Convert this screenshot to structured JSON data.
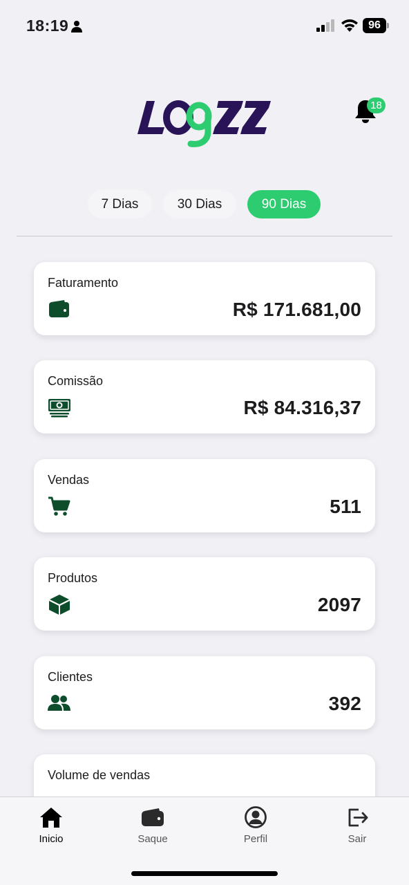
{
  "status_bar": {
    "time": "18:19",
    "battery": "96"
  },
  "header": {
    "logo_text": "LOGZZ",
    "notification_count": "18"
  },
  "tabs": [
    {
      "label": "7 Dias",
      "active": false
    },
    {
      "label": "30 Dias",
      "active": false
    },
    {
      "label": "90 Dias",
      "active": true
    }
  ],
  "cards": [
    {
      "label": "Faturamento",
      "value": "R$ 171.681,00",
      "icon": "wallet-icon"
    },
    {
      "label": "Comissão",
      "value": "R$ 84.316,37",
      "icon": "money-icon"
    },
    {
      "label": "Vendas",
      "value": "511",
      "icon": "cart-icon"
    },
    {
      "label": "Produtos",
      "value": "2097",
      "icon": "box-icon"
    },
    {
      "label": "Clientes",
      "value": "392",
      "icon": "users-icon"
    },
    {
      "label": "Volume de vendas",
      "value": "",
      "icon": ""
    }
  ],
  "bottom_nav": [
    {
      "label": "Inicio",
      "icon": "home-icon",
      "active": true
    },
    {
      "label": "Saque",
      "icon": "wallet-icon",
      "active": false
    },
    {
      "label": "Perfil",
      "icon": "profile-icon",
      "active": false
    },
    {
      "label": "Sair",
      "icon": "logout-icon",
      "active": false
    }
  ],
  "colors": {
    "accent": "#2ecc71",
    "icon_green": "#0e4d2c",
    "logo_purple": "#2a1458"
  }
}
